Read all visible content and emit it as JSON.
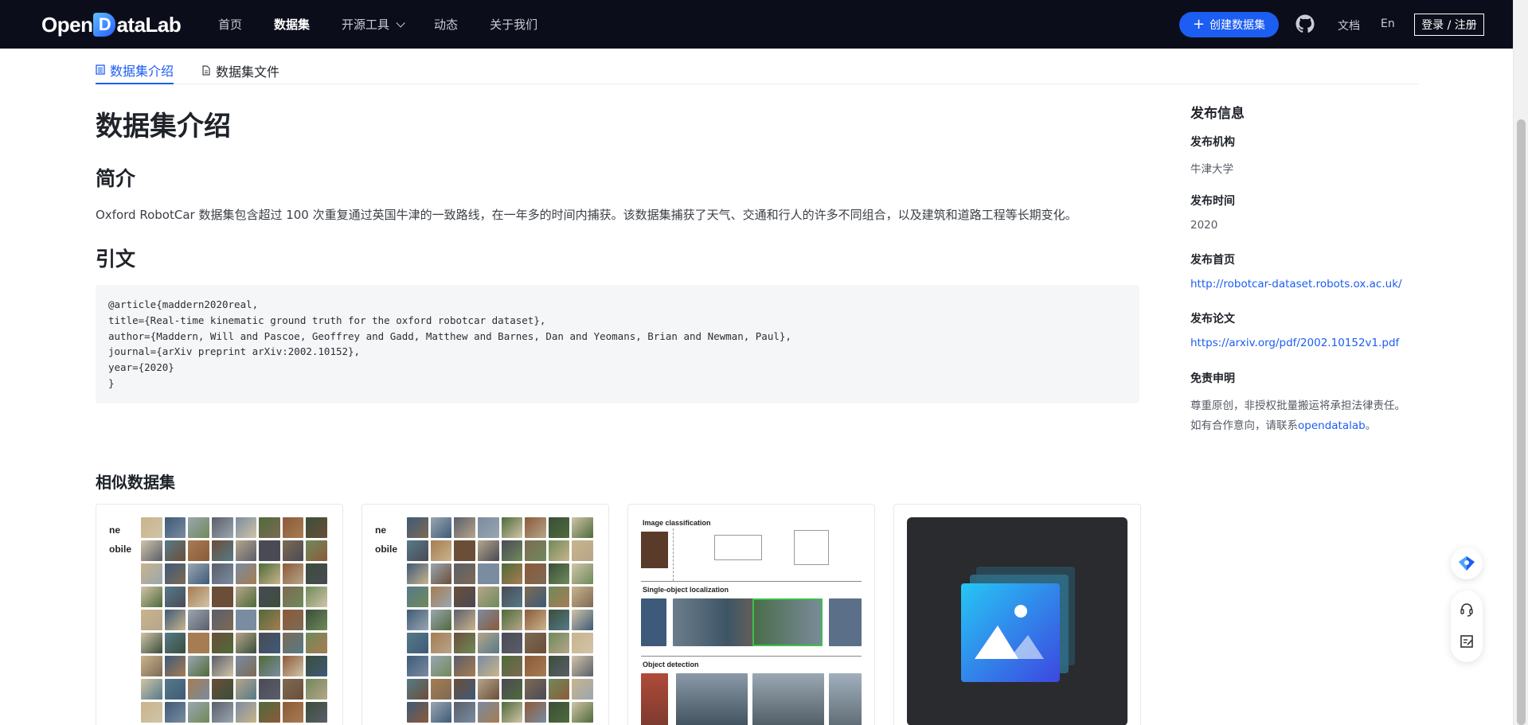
{
  "header": {
    "logo_pre": "Open",
    "logo_mark": "D",
    "logo_post": "ataLab",
    "nav": [
      "首页",
      "数据集",
      "开源工具",
      "动态",
      "关于我们"
    ],
    "active_nav": "数据集",
    "create_label": "创建数据集",
    "docs_label": "文档",
    "lang_label": "En",
    "login_label": "登录 / 注册"
  },
  "tabs": {
    "intro": "数据集介绍",
    "files": "数据集文件"
  },
  "main": {
    "title": "数据集介绍",
    "summary_heading": "简介",
    "summary_text": "Oxford RobotCar 数据集包含超过 100 次重复通过英国牛津的一致路线，在一年多的时间内捕获。该数据集捕获了天气、交通和行人的许多不同组合，以及建筑和道路工程等长期变化。",
    "citation_heading": "引文",
    "citation_lines": [
      "@article{maddern2020real,",
      "title={Real-time kinematic ground truth for the oxford robotcar dataset},",
      "author={Maddern, Will and Pascoe, Geoffrey and Gadd, Matthew and Barnes, Dan and Yeomans, Brian and Newman, Paul},",
      "journal={arXiv preprint arXiv:2002.10152},",
      "year={2020}",
      "}"
    ]
  },
  "sidebar": {
    "title": "发布信息",
    "org_label": "发布机构",
    "org_value": "牛津大学",
    "time_label": "发布时间",
    "time_value": "2020",
    "home_label": "发布首页",
    "home_value": "http://robotcar-dataset.robots.ox.ac.uk/",
    "paper_label": "发布论文",
    "paper_value": "https://arxiv.org/pdf/2002.10152v1.pdf",
    "disclaimer_label": "免责申明",
    "disclaimer_line1": "尊重原创，非授权批量搬运将承担法律责任。",
    "disclaimer_line2_pre": "如有合作意向，请联系",
    "disclaimer_link": "opendatalab",
    "disclaimer_line2_post": "。"
  },
  "similar": {
    "title": "相似数据集",
    "card1_text": [
      "ne",
      "obile"
    ],
    "card2_text": [
      "ne",
      "obile"
    ],
    "card3_sections": [
      "Image classification",
      "Single-object localization",
      "Object detection"
    ]
  },
  "colors": {
    "header_bg": "#0b0e1a",
    "accent": "#1c5df2"
  }
}
